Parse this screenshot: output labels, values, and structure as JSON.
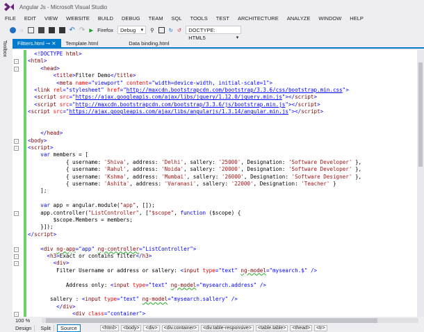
{
  "window": {
    "title": "Angular Js - Microsoft Visual Studio"
  },
  "menu": [
    "FILE",
    "EDIT",
    "VIEW",
    "WEBSITE",
    "BUILD",
    "DEBUG",
    "TEAM",
    "SQL",
    "TOOLS",
    "TEST",
    "ARCHITECTURE",
    "ANALYZE",
    "WINDOW",
    "HELP"
  ],
  "toolbar": {
    "browser": "Firefox",
    "config": "Debug",
    "doctype": "DOCTYPE: HTML5"
  },
  "side": {
    "toolbox": "Toolbox"
  },
  "tabs": [
    {
      "label": "Filtters.html",
      "active": true
    },
    {
      "label": "Template.html"
    },
    {
      "label": "Data binding.html"
    }
  ],
  "code": [
    [
      [
        "d",
        "  <!DOCTYPE "
      ],
      [
        "t",
        "html"
      ],
      [
        "d",
        ">"
      ]
    ],
    [
      [
        "f",
        "-"
      ],
      [
        "d",
        "<"
      ],
      [
        "t",
        "html"
      ],
      [
        "d",
        ">"
      ]
    ],
    [
      [
        "f",
        "-"
      ],
      [
        "d",
        "    <"
      ],
      [
        "t",
        "head"
      ],
      [
        "d",
        ">"
      ]
    ],
    [
      [
        "d",
        "        <"
      ],
      [
        "t",
        "title"
      ],
      [
        "d",
        ">"
      ],
      [
        "p",
        "Filter Demo"
      ],
      [
        "d",
        "</"
      ],
      [
        "t",
        "title"
      ],
      [
        "d",
        ">"
      ]
    ],
    [
      [
        "d",
        "         <"
      ],
      [
        "t",
        "meta "
      ],
      [
        "a",
        "name"
      ],
      [
        "d",
        "=\""
      ],
      [
        "v",
        "viewport"
      ],
      [
        "d",
        "\" "
      ],
      [
        "a",
        "content"
      ],
      [
        "d",
        "=\""
      ],
      [
        "v",
        "width=device-width, initial-scale=1"
      ],
      [
        "d",
        "\">"
      ]
    ],
    [
      [
        "d",
        "  <"
      ],
      [
        "t",
        "link "
      ],
      [
        "a",
        "rel"
      ],
      [
        "d",
        "=\""
      ],
      [
        "v",
        "stylesheet"
      ],
      [
        "d",
        "\" "
      ],
      [
        "a",
        "href"
      ],
      [
        "d",
        "=\""
      ],
      [
        "u",
        "http://maxcdn.bootstrapcdn.com/bootstrap/3.3.6/css/bootstrap.min.css"
      ],
      [
        "d",
        "\">"
      ]
    ],
    [
      [
        "d",
        "  <"
      ],
      [
        "t",
        "script "
      ],
      [
        "a",
        "src"
      ],
      [
        "d",
        "=\""
      ],
      [
        "u",
        "https://ajax.googleapis.com/ajax/libs/jquery/1.12.0/jquery.min.js"
      ],
      [
        "d",
        "\"></"
      ],
      [
        "t",
        "script"
      ],
      [
        "d",
        ">"
      ]
    ],
    [
      [
        "d",
        "  <"
      ],
      [
        "t",
        "script "
      ],
      [
        "a",
        "src"
      ],
      [
        "d",
        "=\""
      ],
      [
        "u",
        "http://maxcdn.bootstrapcdn.com/bootstrap/3.3.6/js/bootstrap.min.js"
      ],
      [
        "d",
        "\"></"
      ],
      [
        "t",
        "script"
      ],
      [
        "d",
        ">"
      ]
    ],
    [
      [
        "d",
        "<"
      ],
      [
        "t",
        "script "
      ],
      [
        "a",
        "src"
      ],
      [
        "d",
        "=\""
      ],
      [
        "u",
        "https://ajax.googleapis.com/ajax/libs/angularjs/1.3.14/angular.min.js"
      ],
      [
        "d",
        "\"></"
      ],
      [
        "t",
        "script"
      ],
      [
        "d",
        ">"
      ]
    ],
    [],
    [],
    [
      [
        "d",
        "    </"
      ],
      [
        "t",
        "head"
      ],
      [
        "d",
        ">"
      ]
    ],
    [
      [
        "f",
        "-"
      ],
      [
        "d",
        "<"
      ],
      [
        "t",
        "body"
      ],
      [
        "d",
        ">"
      ]
    ],
    [
      [
        "f",
        "-"
      ],
      [
        "d",
        "<"
      ],
      [
        "t",
        "script"
      ],
      [
        "d",
        ">"
      ]
    ],
    [
      [
        "k",
        "    var "
      ],
      [
        "p",
        "members = ["
      ]
    ],
    [
      [
        "p",
        "            { username: "
      ],
      [
        "s",
        "'Shiva'"
      ],
      [
        "p",
        ", address: "
      ],
      [
        "s",
        "'Delhi'"
      ],
      [
        "p",
        ", sallery: "
      ],
      [
        "s",
        "'25000'"
      ],
      [
        "p",
        ", Designation: "
      ],
      [
        "s",
        "'Software Developer'"
      ],
      [
        "p",
        " },"
      ]
    ],
    [
      [
        "p",
        "            { username: "
      ],
      [
        "s",
        "'Rahul'"
      ],
      [
        "p",
        ", address: "
      ],
      [
        "s",
        "'Noida'"
      ],
      [
        "p",
        ", sallery: "
      ],
      [
        "s",
        "'20000'"
      ],
      [
        "p",
        ", Designation: "
      ],
      [
        "s",
        "'Software Developer'"
      ],
      [
        "p",
        " },"
      ]
    ],
    [
      [
        "p",
        "            { username: "
      ],
      [
        "s",
        "'Kshma'"
      ],
      [
        "p",
        ", address: "
      ],
      [
        "s",
        "'Mumbai'"
      ],
      [
        "p",
        ", sallery: "
      ],
      [
        "s",
        "'26000'"
      ],
      [
        "p",
        ", Designation: "
      ],
      [
        "s",
        "'Software Designer'"
      ],
      [
        "p",
        " },"
      ]
    ],
    [
      [
        "p",
        "            { username: "
      ],
      [
        "s",
        "'Ashita'"
      ],
      [
        "p",
        ", address: "
      ],
      [
        "s",
        "'Varanasi'"
      ],
      [
        "p",
        ", sallery: "
      ],
      [
        "s",
        "'22000'"
      ],
      [
        "p",
        ", Designation: "
      ],
      [
        "s",
        "'Teacher'"
      ],
      [
        "p",
        " }"
      ]
    ],
    [
      [
        "p",
        "    ];"
      ]
    ],
    [],
    [
      [
        "k",
        "    var "
      ],
      [
        "p",
        "app = angular.module("
      ],
      [
        "s",
        "\"app\""
      ],
      [
        "p",
        ", []);"
      ]
    ],
    [
      [
        "f",
        "-"
      ],
      [
        "p",
        "    app.controller("
      ],
      [
        "s",
        "\"ListController\""
      ],
      [
        "p",
        ", ["
      ],
      [
        "s",
        "\"$scope\""
      ],
      [
        "p",
        ", "
      ],
      [
        "k",
        "function "
      ],
      [
        "p",
        "($scope) {"
      ]
    ],
    [
      [
        "p",
        "        $scope.Members = members;"
      ]
    ],
    [
      [
        "p",
        "    }]);"
      ]
    ],
    [
      [
        "d",
        "</"
      ],
      [
        "t",
        "script"
      ],
      [
        "d",
        ">"
      ]
    ],
    [],
    [
      [
        "f",
        "-"
      ],
      [
        "d",
        "    <"
      ],
      [
        "t",
        "div "
      ],
      [
        "w",
        "ng-app"
      ],
      [
        "d",
        "=\""
      ],
      [
        "v",
        "app"
      ],
      [
        "d",
        "\" "
      ],
      [
        "w",
        "ng-controller"
      ],
      [
        "d",
        "=\""
      ],
      [
        "v",
        "ListController"
      ],
      [
        "d",
        "\">"
      ]
    ],
    [
      [
        "f",
        "-"
      ],
      [
        "d",
        "      <"
      ],
      [
        "t",
        "h3"
      ],
      [
        "d",
        ">"
      ],
      [
        "p",
        "Exact or contains filter"
      ],
      [
        "d",
        "</"
      ],
      [
        "t",
        "h3"
      ],
      [
        "d",
        ">"
      ]
    ],
    [
      [
        "f",
        "-"
      ],
      [
        "d",
        "        <"
      ],
      [
        "t",
        "div"
      ],
      [
        "d",
        ">"
      ]
    ],
    [
      [
        "p",
        "         Filter Username or address or sallery: "
      ],
      [
        "d",
        "<"
      ],
      [
        "t",
        "input "
      ],
      [
        "a",
        "type"
      ],
      [
        "d",
        "=\""
      ],
      [
        "v",
        "text"
      ],
      [
        "d",
        "\" "
      ],
      [
        "w",
        "ng-model"
      ],
      [
        "d",
        "=\""
      ],
      [
        "v",
        "mysearch.$"
      ],
      [
        "d",
        "\" />"
      ]
    ],
    [],
    [
      [
        "p",
        "            Address only: "
      ],
      [
        "d",
        "<"
      ],
      [
        "t",
        "input "
      ],
      [
        "a",
        "type"
      ],
      [
        "d",
        "=\""
      ],
      [
        "v",
        "text"
      ],
      [
        "d",
        "\" "
      ],
      [
        "w",
        "ng-model"
      ],
      [
        "d",
        "=\""
      ],
      [
        "v",
        "mysearch.address"
      ],
      [
        "d",
        "\" />"
      ]
    ],
    [],
    [
      [
        "p",
        "       sallery : "
      ],
      [
        "d",
        "<"
      ],
      [
        "t",
        "input "
      ],
      [
        "a",
        "type"
      ],
      [
        "d",
        "=\""
      ],
      [
        "v",
        "text"
      ],
      [
        "d",
        "\" "
      ],
      [
        "w",
        "ng-model"
      ],
      [
        "d",
        "=\""
      ],
      [
        "v",
        "mysearch.sallery"
      ],
      [
        "d",
        "\" />"
      ]
    ],
    [
      [
        "d",
        "         </"
      ],
      [
        "t",
        "div"
      ],
      [
        "d",
        ">"
      ]
    ],
    [
      [
        "f",
        "-"
      ],
      [
        "d",
        "              <"
      ],
      [
        "t",
        "div "
      ],
      [
        "a",
        "class"
      ],
      [
        "d",
        "=\""
      ],
      [
        "v",
        "container"
      ],
      [
        "d",
        "\">"
      ]
    ]
  ],
  "status": {
    "zoom": "100 %",
    "views": [
      "Design",
      "Split",
      "Source"
    ],
    "active_view": "Source",
    "breadcrumb": [
      "<html>",
      "<body>",
      "<div>",
      "<div.container>",
      "<div.table-responsive>",
      "<table.table>",
      "<thead>",
      "<tr>"
    ]
  }
}
